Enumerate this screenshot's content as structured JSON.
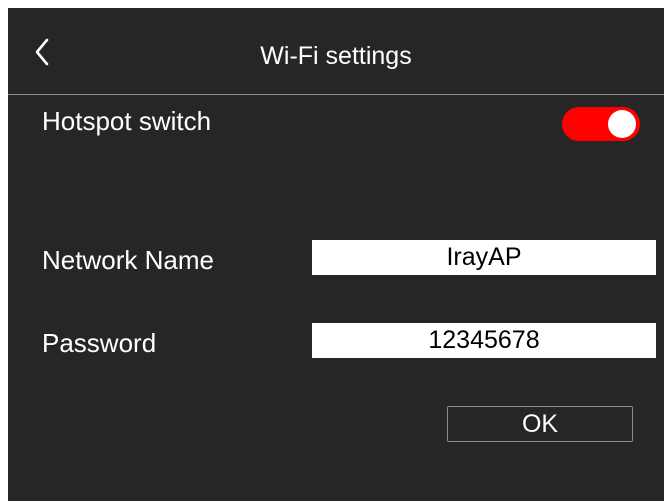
{
  "header": {
    "title": "Wi-Fi settings",
    "back_icon": "chevron-left-icon"
  },
  "hotspot": {
    "label": "Hotspot switch",
    "enabled": true,
    "on_color": "#ff0000"
  },
  "network_name": {
    "label": "Network Name",
    "value": "IrayAP"
  },
  "password": {
    "label": "Password",
    "value": "12345678"
  },
  "ok_button": {
    "label": "OK"
  },
  "colors": {
    "background": "#262626",
    "text": "#ffffff",
    "field_background": "#ffffff"
  }
}
